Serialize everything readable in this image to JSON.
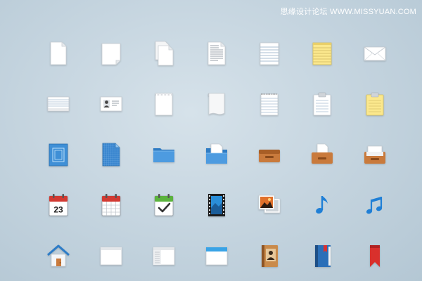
{
  "watermark": "思缘设计论坛 WWW.MISSYUAN.COM",
  "calendar_day": "23",
  "icons": [
    {
      "name": "blank-document-icon"
    },
    {
      "name": "folded-corner-document-icon"
    },
    {
      "name": "multiple-documents-icon"
    },
    {
      "name": "text-document-icon"
    },
    {
      "name": "lined-notepad-icon"
    },
    {
      "name": "yellow-legal-pad-icon"
    },
    {
      "name": "envelope-icon"
    },
    {
      "name": "stacked-sheets-icon"
    },
    {
      "name": "contact-card-icon"
    },
    {
      "name": "perforated-notepad-icon"
    },
    {
      "name": "curled-paper-icon"
    },
    {
      "name": "spiral-notepad-icon"
    },
    {
      "name": "clipboard-icon"
    },
    {
      "name": "yellow-clipboard-icon"
    },
    {
      "name": "blueprint-document-icon"
    },
    {
      "name": "blueprint-folded-document-icon"
    },
    {
      "name": "blue-folder-icon"
    },
    {
      "name": "folder-with-document-icon"
    },
    {
      "name": "wooden-tray-icon"
    },
    {
      "name": "tray-with-documents-icon"
    },
    {
      "name": "inbox-tray-icon"
    },
    {
      "name": "calendar-icon"
    },
    {
      "name": "calendar-grid-icon"
    },
    {
      "name": "calendar-check-icon"
    },
    {
      "name": "film-strip-icon"
    },
    {
      "name": "photos-icon"
    },
    {
      "name": "music-note-icon"
    },
    {
      "name": "music-notes-icon"
    },
    {
      "name": "home-icon"
    },
    {
      "name": "blank-window-icon"
    },
    {
      "name": "sidebar-window-icon"
    },
    {
      "name": "browser-window-icon"
    },
    {
      "name": "address-book-icon"
    },
    {
      "name": "bookmarked-book-icon"
    },
    {
      "name": "red-bookmark-icon"
    }
  ]
}
